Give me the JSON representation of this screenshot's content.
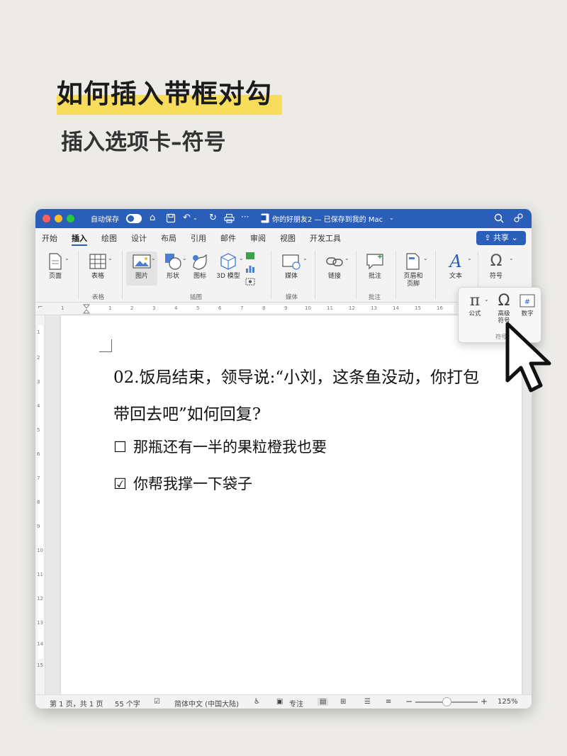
{
  "heading": {
    "title": "如何插入带框对勾",
    "subtitle": "插入选项卡–符号"
  },
  "titlebar": {
    "autosave_label": "自动保存",
    "doc_title": "你的好朋友2 — 已保存到我的 Mac",
    "more": "···"
  },
  "tabs": [
    {
      "label": "开始"
    },
    {
      "label": "插入"
    },
    {
      "label": "绘图"
    },
    {
      "label": "设计"
    },
    {
      "label": "布局"
    },
    {
      "label": "引用"
    },
    {
      "label": "邮件"
    },
    {
      "label": "审阅"
    },
    {
      "label": "视图"
    },
    {
      "label": "开发工具"
    }
  ],
  "share_label": "共享",
  "ribbon": {
    "page": "页面",
    "table": "表格",
    "picture": "图片",
    "shapes": "形状",
    "icons": "图标",
    "model3d": "3D 模型",
    "media": "媒体",
    "link": "链接",
    "comment": "批注",
    "header_footer": "页眉和\n页脚",
    "text": "文本",
    "symbol": "符号",
    "groups": {
      "table": "表格",
      "illustrations": "插图",
      "media": "媒体",
      "comments": "批注"
    }
  },
  "symbol_popup": {
    "equation": "公式",
    "advanced_symbol": "高级\n符号",
    "number": "数字",
    "group": "符号"
  },
  "ruler_numbers": [
    "1",
    "1",
    "2",
    "3",
    "4",
    "5",
    "6",
    "7",
    "8",
    "9",
    "10",
    "11",
    "12",
    "13",
    "14",
    "15",
    "16"
  ],
  "vruler_numbers": [
    "1",
    "2",
    "3",
    "4",
    "5",
    "6",
    "7",
    "8",
    "9",
    "10",
    "11",
    "12",
    "13",
    "14",
    "15"
  ],
  "document": {
    "question_line1": "02.饭局结束，领导说:“小刘，这条鱼没动，你打包",
    "question_line2": "带回去吧”如何回复?",
    "options": [
      {
        "box": "☐",
        "text": "那瓶还有一半的果粒橙我也要"
      },
      {
        "box": "☑",
        "text": "你帮我撑一下袋子"
      }
    ]
  },
  "status": {
    "page": "第 1 页，共 1 页",
    "words": "55 个字",
    "language": "简体中文 (中国大陆)",
    "focus": "专注",
    "zoom_minus": "−",
    "zoom_plus": "+",
    "zoom": "125%",
    "zoom_fraction": 0.5
  },
  "colors": {
    "titlebar": "#2b5eb9",
    "highlight": "#f8dd5c",
    "close": "#ff5f57",
    "minimize": "#febc2e",
    "maximize": "#28c840"
  },
  "icons": {
    "close": "close-icon",
    "cursor": "mouse-pointer-icon",
    "checkbox_empty": "empty-checkbox-icon",
    "checkbox_checked": "checked-checkbox-icon"
  }
}
